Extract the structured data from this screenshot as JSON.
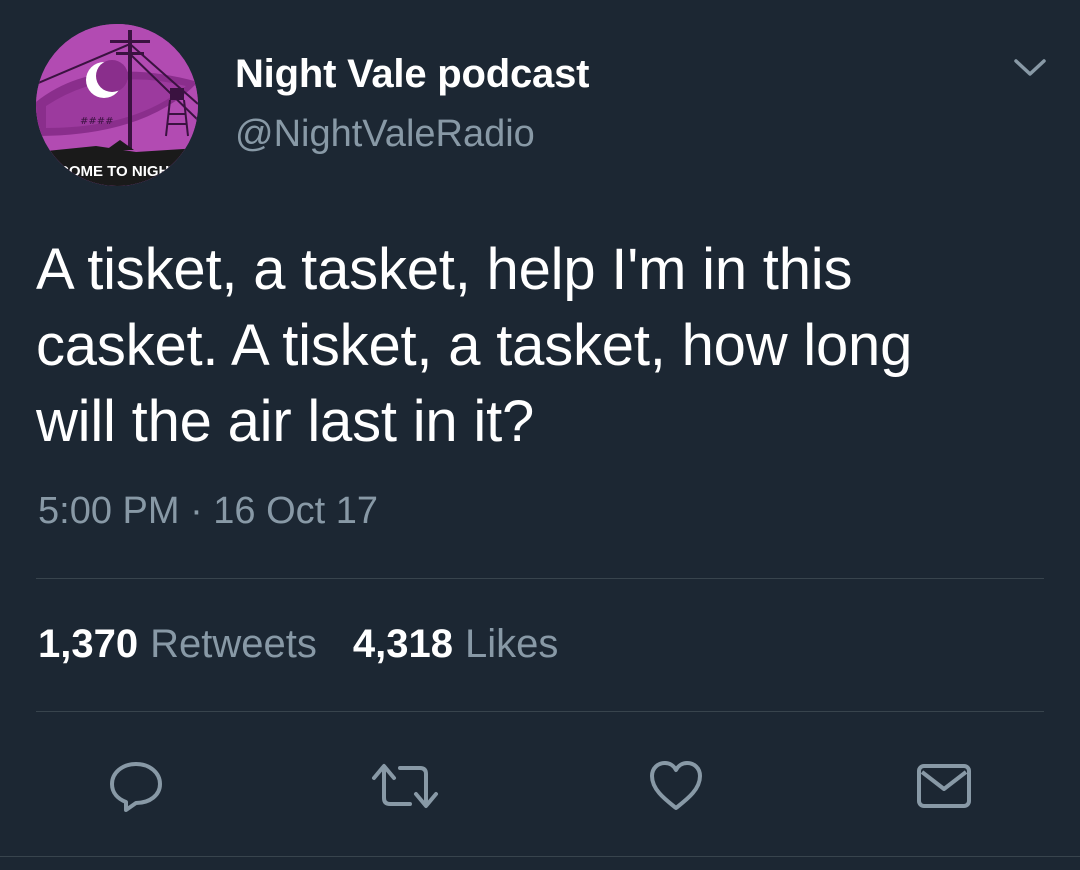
{
  "author": {
    "name": "Night Vale podcast",
    "handle": "@NightValeRadio",
    "avatar_text": "COME TO NIGHT V"
  },
  "tweet": {
    "text": "A tisket, a tasket, help I'm in this\ncasket. A tisket, a tasket, how long\nwill the air last in it?",
    "timestamp": "5:00 PM · 16 Oct 17"
  },
  "stats": {
    "retweets_count": "1,370",
    "retweets_label": "Retweets",
    "likes_count": "4,318",
    "likes_label": "Likes"
  },
  "icons": {
    "caret": "chevron-down-icon",
    "reply": "reply-icon",
    "retweet": "retweet-icon",
    "like": "heart-icon",
    "message": "envelope-icon"
  },
  "colors": {
    "background": "#1c2733",
    "text": "#ffffff",
    "secondary": "#8899a6",
    "divider": "#38444d",
    "avatar": "#b24bb2"
  }
}
